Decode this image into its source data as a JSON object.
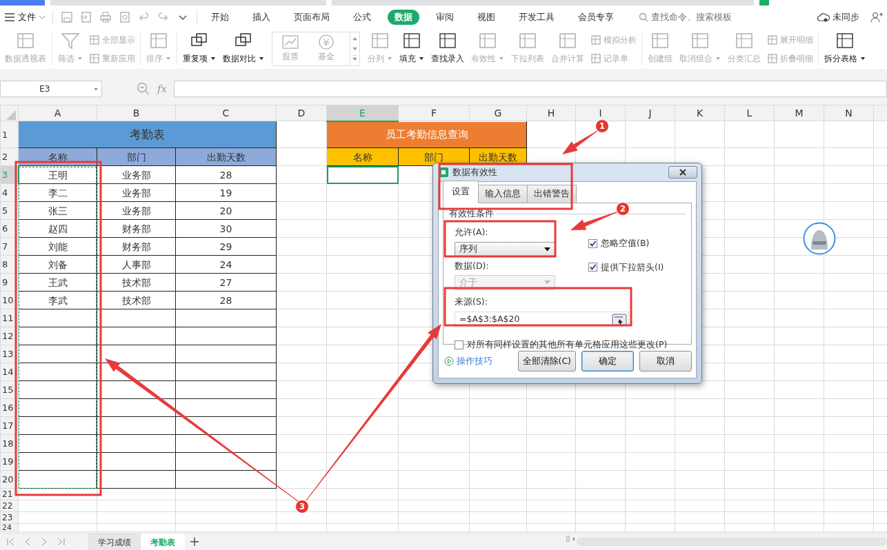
{
  "browser_tabs": [
    {
      "kind": "home",
      "selected": false
    },
    {
      "kind": "document",
      "selected": false
    },
    {
      "kind": "document",
      "selected": false
    },
    {
      "kind": "document",
      "selected": true
    }
  ],
  "menu": {
    "file": "文件"
  },
  "ribbon_tabs": [
    {
      "label": "开始",
      "selected": false
    },
    {
      "label": "插入",
      "selected": false
    },
    {
      "label": "页面布局",
      "selected": false
    },
    {
      "label": "公式",
      "selected": false
    },
    {
      "label": "数据",
      "selected": true
    },
    {
      "label": "审阅",
      "selected": false
    },
    {
      "label": "视图",
      "selected": false
    },
    {
      "label": "开发工具",
      "selected": false
    },
    {
      "label": "会员专享",
      "selected": false
    }
  ],
  "search": {
    "placeholder": "查找命令、搜索模板"
  },
  "sync_status": "未同步",
  "ribbon": [
    {
      "kind": "large",
      "label": "数据透视表",
      "caret": false,
      "disabled": true
    },
    {
      "kind": "separator"
    },
    {
      "kind": "large",
      "label": "筛选",
      "caret": true,
      "disabled": true
    },
    {
      "kind": "stack",
      "items": [
        {
          "label": "全部显示",
          "disabled": true
        },
        {
          "label": "重新应用",
          "disabled": true
        }
      ]
    },
    {
      "kind": "separator"
    },
    {
      "kind": "large",
      "label": "排序",
      "caret": true,
      "disabled": true
    },
    {
      "kind": "separator"
    },
    {
      "kind": "large",
      "label": "重复项",
      "caret": true,
      "disabled": false
    },
    {
      "kind": "large",
      "label": "数据对比",
      "caret": true,
      "disabled": false
    },
    {
      "kind": "gallery",
      "items": [
        {
          "label": "股票",
          "disabled": true
        },
        {
          "label": "基金",
          "disabled": true
        }
      ]
    },
    {
      "kind": "large",
      "label": "分列",
      "caret": true,
      "disabled": true
    },
    {
      "kind": "large",
      "label": "填充",
      "caret": true,
      "disabled": false
    },
    {
      "kind": "large",
      "label": "查找录入",
      "caret": false,
      "disabled": false
    },
    {
      "kind": "large",
      "label": "有效性",
      "caret": true,
      "disabled": true
    },
    {
      "kind": "large",
      "label": "下拉列表",
      "caret": false,
      "disabled": true
    },
    {
      "kind": "large",
      "label": "合并计算",
      "caret": false,
      "disabled": true
    },
    {
      "kind": "stack",
      "items": [
        {
          "label": "模拟分析",
          "disabled": true
        },
        {
          "label": "记录单",
          "disabled": true
        }
      ]
    },
    {
      "kind": "separator"
    },
    {
      "kind": "large",
      "label": "创建组",
      "caret": false,
      "disabled": true
    },
    {
      "kind": "large",
      "label": "取消组合",
      "caret": true,
      "disabled": true
    },
    {
      "kind": "large",
      "label": "分类汇总",
      "caret": false,
      "disabled": true
    },
    {
      "kind": "stack",
      "items": [
        {
          "label": "展开明细",
          "disabled": true
        },
        {
          "label": "折叠明细",
          "disabled": true
        }
      ]
    },
    {
      "kind": "separator"
    },
    {
      "kind": "large",
      "label": "拆分表格",
      "caret": true,
      "disabled": false
    }
  ],
  "formula_bar": {
    "cell_ref": "E3",
    "fx": "fx"
  },
  "sheet": {
    "columns": [
      {
        "letter": "A",
        "selected": false
      },
      {
        "letter": "B",
        "selected": false
      },
      {
        "letter": "C",
        "selected": false
      },
      {
        "letter": "D",
        "selected": false
      },
      {
        "letter": "E",
        "selected": true
      },
      {
        "letter": "F",
        "selected": false
      },
      {
        "letter": "G",
        "selected": false
      },
      {
        "letter": "H",
        "selected": false
      },
      {
        "letter": "I",
        "selected": false
      },
      {
        "letter": "J",
        "selected": false
      },
      {
        "letter": "K",
        "selected": false
      },
      {
        "letter": "L",
        "selected": false
      },
      {
        "letter": "M",
        "selected": false
      },
      {
        "letter": "N",
        "selected": false
      }
    ],
    "row_numbers": [
      {
        "label": "1",
        "selected": false
      },
      {
        "label": "2",
        "selected": false
      },
      {
        "label": "3",
        "selected": true
      },
      {
        "label": "4",
        "selected": false
      },
      {
        "label": "5",
        "selected": false
      },
      {
        "label": "6",
        "selected": false
      },
      {
        "label": "7",
        "selected": false
      },
      {
        "label": "8",
        "selected": false
      },
      {
        "label": "9",
        "selected": false
      },
      {
        "label": "10",
        "selected": false
      },
      {
        "label": "11",
        "selected": false
      },
      {
        "label": "12",
        "selected": false
      },
      {
        "label": "13",
        "selected": false
      },
      {
        "label": "14",
        "selected": false
      },
      {
        "label": "15",
        "selected": false
      },
      {
        "label": "16",
        "selected": false
      },
      {
        "label": "17",
        "selected": false
      },
      {
        "label": "18",
        "selected": false
      },
      {
        "label": "19",
        "selected": false
      },
      {
        "label": "20",
        "selected": false
      },
      {
        "label": "21",
        "selected": false
      },
      {
        "label": "22",
        "selected": false
      },
      {
        "label": "23",
        "selected": false
      },
      {
        "label": "24",
        "selected": false
      }
    ],
    "attendance": {
      "title": "考勤表",
      "headers": [
        "名称",
        "部门",
        "出勤天数"
      ],
      "records": [
        {
          "name": "王明",
          "department": "业务部",
          "days": "28"
        },
        {
          "name": "李二",
          "department": "业务部",
          "days": "19"
        },
        {
          "name": "张三",
          "department": "业务部",
          "days": "20"
        },
        {
          "name": "赵四",
          "department": "财务部",
          "days": "30"
        },
        {
          "name": "刘能",
          "department": "财务部",
          "days": "29"
        },
        {
          "name": "刘备",
          "department": "人事部",
          "days": "24"
        },
        {
          "name": "王武",
          "department": "技术部",
          "days": "27"
        },
        {
          "name": "李武",
          "department": "技术部",
          "days": "28"
        }
      ]
    },
    "lookup": {
      "title": "员工考勤信息查询",
      "headers": [
        "名称",
        "部门",
        "出勤天数"
      ]
    }
  },
  "dialog": {
    "title": "数据有效性",
    "tabs": [
      {
        "label": "设置",
        "selected": true
      },
      {
        "label": "输入信息",
        "selected": false
      },
      {
        "label": "出错警告",
        "selected": false
      }
    ],
    "group_label": "有效性条件",
    "allow": {
      "label": "允许(A):",
      "value": "序列",
      "disabled": false
    },
    "data": {
      "label": "数据(D):",
      "value": "介于",
      "disabled": true
    },
    "checkboxes": [
      {
        "label": "忽略空值(B)",
        "checked": true
      },
      {
        "label": "提供下拉箭头(I)",
        "checked": true
      }
    ],
    "source": {
      "label": "来源(S):",
      "value": "=$A$3:$A$20"
    },
    "apply_all": {
      "label": "对所有同样设置的其他所有单元格应用这些更改(P)",
      "checked": false
    },
    "tips_link": "操作技巧",
    "buttons": [
      {
        "label": "全部清除(C)",
        "default": false
      },
      {
        "label": "确定",
        "default": true
      },
      {
        "label": "取消",
        "default": false
      }
    ]
  },
  "annotations": [
    {
      "label": "1"
    },
    {
      "label": "2"
    },
    {
      "label": "3"
    }
  ],
  "sheet_tabs": [
    {
      "label": "学习成绩",
      "selected": false
    },
    {
      "label": "考勤表",
      "selected": true
    }
  ]
}
